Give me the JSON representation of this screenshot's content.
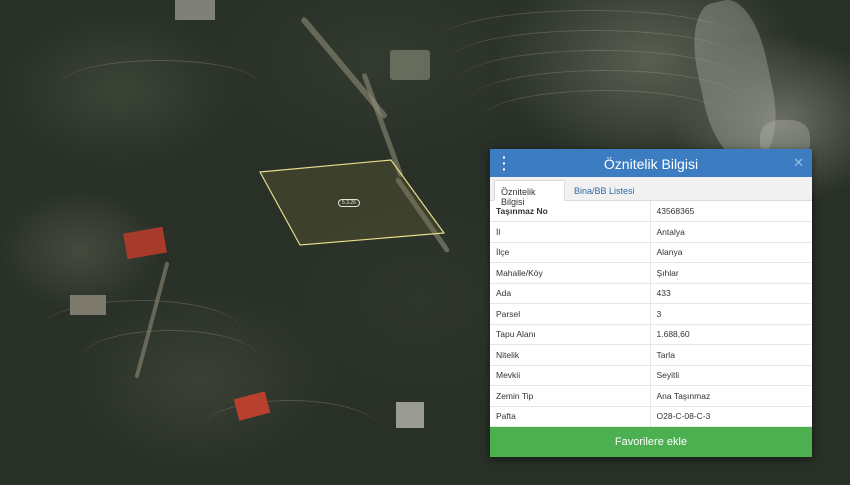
{
  "map": {
    "parcel_label": "5.3.26"
  },
  "panel": {
    "title": "Öznitelik Bilgisi",
    "menu_icon": "vertical-dots-icon",
    "close_icon": "close-icon",
    "tabs": [
      {
        "label": "Öznitelik Bilgisi",
        "active": true
      },
      {
        "label": "Bina/BB Listesi",
        "active": false
      }
    ],
    "rows": [
      {
        "key": "Taşınmaz No",
        "value": "43568365"
      },
      {
        "key": "İl",
        "value": "Antalya"
      },
      {
        "key": "İlçe",
        "value": "Alanya"
      },
      {
        "key": "Mahalle/Köy",
        "value": "Şıhlar"
      },
      {
        "key": "Ada",
        "value": "433"
      },
      {
        "key": "Parsel",
        "value": "3"
      },
      {
        "key": "Tapu Alanı",
        "value": "1.688,60"
      },
      {
        "key": "Nitelik",
        "value": "Tarla"
      },
      {
        "key": "Mevkii",
        "value": "Seyitli"
      },
      {
        "key": "Zemin Tip",
        "value": "Ana Taşınmaz"
      },
      {
        "key": "Pafta",
        "value": "O28-C-08-C-3"
      }
    ],
    "favorite_button": "Favorilere ekle",
    "colors": {
      "header": "#3b7dc0",
      "button": "#4caf50",
      "parcel_outline": "#e6dc8a"
    }
  }
}
